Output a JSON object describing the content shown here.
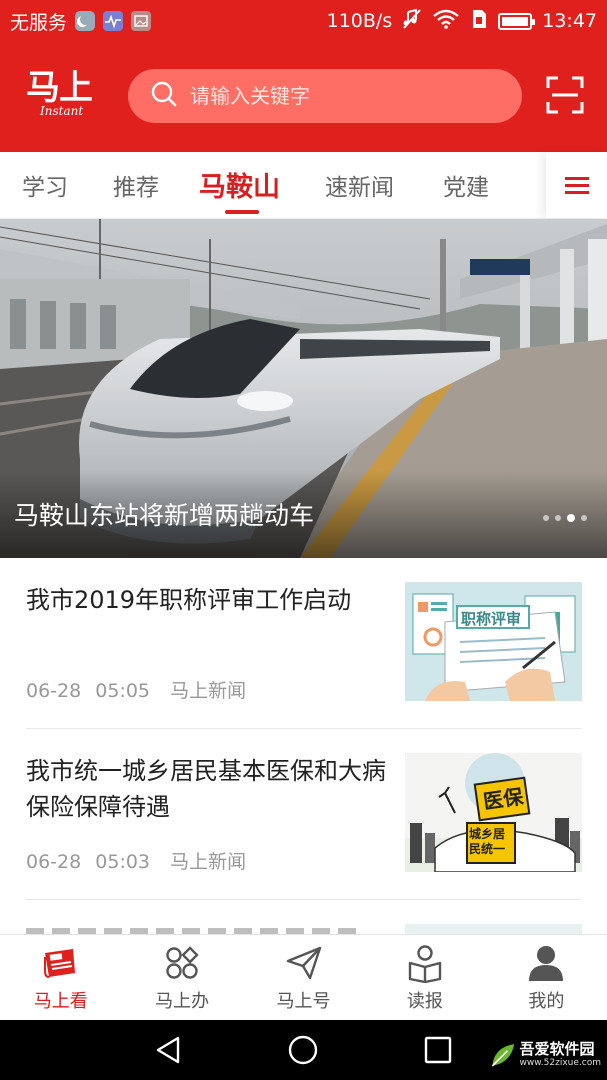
{
  "status_bar": {
    "carrier": "无服务",
    "speed": "110B/s",
    "time": "13:47"
  },
  "header": {
    "logo_main": "马上",
    "logo_sub": "Instant",
    "search_placeholder": "请输入关键字",
    "scan_icon": "scan-icon"
  },
  "tabs": {
    "items": [
      {
        "label": "学习"
      },
      {
        "label": "推荐"
      },
      {
        "label": "马鞍山"
      },
      {
        "label": "速新闻"
      },
      {
        "label": "党建"
      }
    ],
    "active_index": 2,
    "menu_icon": "menu-icon"
  },
  "banner": {
    "title": "马鞍山东站将新增两趟动车",
    "slide_count": 4,
    "active_slide": 3
  },
  "news": [
    {
      "title": "我市2019年职称评审工作启动",
      "date": "06-28",
      "time": "05:05",
      "source": "马上新闻",
      "thumb_text": "职称评审"
    },
    {
      "title": "我市统一城乡居民基本医保和大病保险保障待遇",
      "date": "06-28",
      "time": "05:03",
      "source": "马上新闻",
      "thumb_text_1": "医保",
      "thumb_text_2": "城乡居民统一"
    }
  ],
  "bottom_nav": [
    {
      "label": "马上看",
      "icon": "newspaper-icon",
      "active": true
    },
    {
      "label": "马上办",
      "icon": "grid-icon",
      "active": false
    },
    {
      "label": "马上号",
      "icon": "send-icon",
      "active": false
    },
    {
      "label": "读报",
      "icon": "reader-icon",
      "active": false
    },
    {
      "label": "我的",
      "icon": "user-icon",
      "active": false
    }
  ],
  "watermark": {
    "line1": "吾爱软件园",
    "line2": "www.52zixue.com"
  },
  "colors": {
    "brand_red": "#e0201c",
    "tab_active": "#d81e1e",
    "meta_gray": "#999999"
  }
}
